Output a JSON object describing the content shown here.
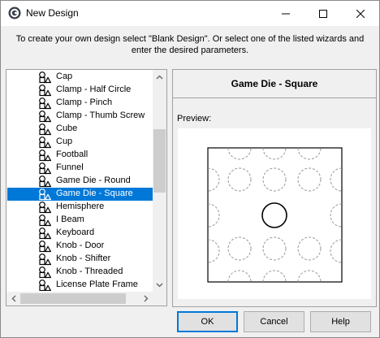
{
  "window": {
    "title": "New Design",
    "icon": "app-logo-icon",
    "controls": [
      "minimize-icon",
      "maximize-icon",
      "close-icon"
    ]
  },
  "instructions": "To create your own design select \"Blank Design\". Or select one of the listed wizards and enter the desired parameters.",
  "wizard_list": {
    "item_icon": "wizard-shape-icon",
    "selected_index": 9,
    "items": [
      "Cap",
      "Clamp - Half Circle",
      "Clamp - Pinch",
      "Clamp - Thumb Screw",
      "Cube",
      "Cup",
      "Football",
      "Funnel",
      "Game Die - Round",
      "Game Die - Square",
      "Hemisphere",
      "I Beam",
      "Keyboard",
      "Knob - Door",
      "Knob - Shifter",
      "Knob - Threaded",
      "License Plate Frame"
    ]
  },
  "detail_panel": {
    "title": "Game Die - Square",
    "preview_label": "Preview:"
  },
  "buttons": {
    "ok": "OK",
    "cancel": "Cancel",
    "help": "Help"
  },
  "colors": {
    "selection": "#0078d7",
    "dialog_bg": "#f0f0f0",
    "list_bg": "#ffffff"
  }
}
